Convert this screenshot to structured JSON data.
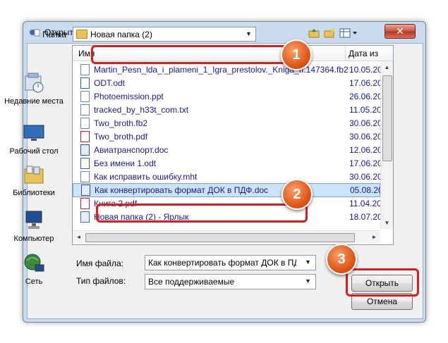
{
  "window": {
    "title": "Открыть",
    "close_glyph": "✕"
  },
  "toolbar": {
    "lookin_label": "Папка",
    "lookin_value": "Новая папка (2)"
  },
  "places": [
    {
      "label": "Недавние места",
      "icon": "recent-places-icon"
    },
    {
      "label": "Рабочий стол",
      "icon": "desktop-icon"
    },
    {
      "label": "Библиотеки",
      "icon": "libraries-icon"
    },
    {
      "label": "Компьютер",
      "icon": "computer-icon"
    },
    {
      "label": "Сеть",
      "icon": "network-icon"
    }
  ],
  "filelist": {
    "columns": {
      "name": "Имя",
      "date": "Дата из"
    },
    "rows": [
      {
        "name": "Martin_Pesn_lda_i_plameni_1_Igra_prestolov._Kniga_II.147364.fb2",
        "date": "10.05.20"
      },
      {
        "name": "ODT.odt",
        "date": "17.06.20"
      },
      {
        "name": "Photoemission.ppt",
        "date": "26.06.20"
      },
      {
        "name": "tracked_by_h33t_com.txt",
        "date": "11.05.20"
      },
      {
        "name": "Two_broth.fb2",
        "date": "30.06.20"
      },
      {
        "name": "Two_broth.pdf",
        "date": "30.06.20"
      },
      {
        "name": "Авиатранспорт.doc",
        "date": "12.06.20"
      },
      {
        "name": "Без имени 1.odt",
        "date": "17.06.20"
      },
      {
        "name": "Как исправить ошибку.mht",
        "date": "30.06.20"
      },
      {
        "name": "Как конвертировать формат ДОК в ПДФ.doc",
        "date": "05.08.20"
      },
      {
        "name": "Книга 2.pdf",
        "date": "11.04.20"
      },
      {
        "name": "Новая папка (2) - Ярлык",
        "date": "18.07.20"
      }
    ],
    "selected_index": 9
  },
  "form": {
    "filename_label": "Имя файла:",
    "filename_value": "Как конвертировать формат ДОК в ПДФ.doc",
    "filetype_label": "Тип файлов:",
    "filetype_value": "Все поддерживаемые",
    "open_button": "Открыть",
    "cancel_button": "Отмена"
  },
  "badges": [
    "1",
    "2",
    "3"
  ],
  "colors": {
    "highlight": "#d42020",
    "badge": "#e05818",
    "selection": "#cce4f7"
  }
}
